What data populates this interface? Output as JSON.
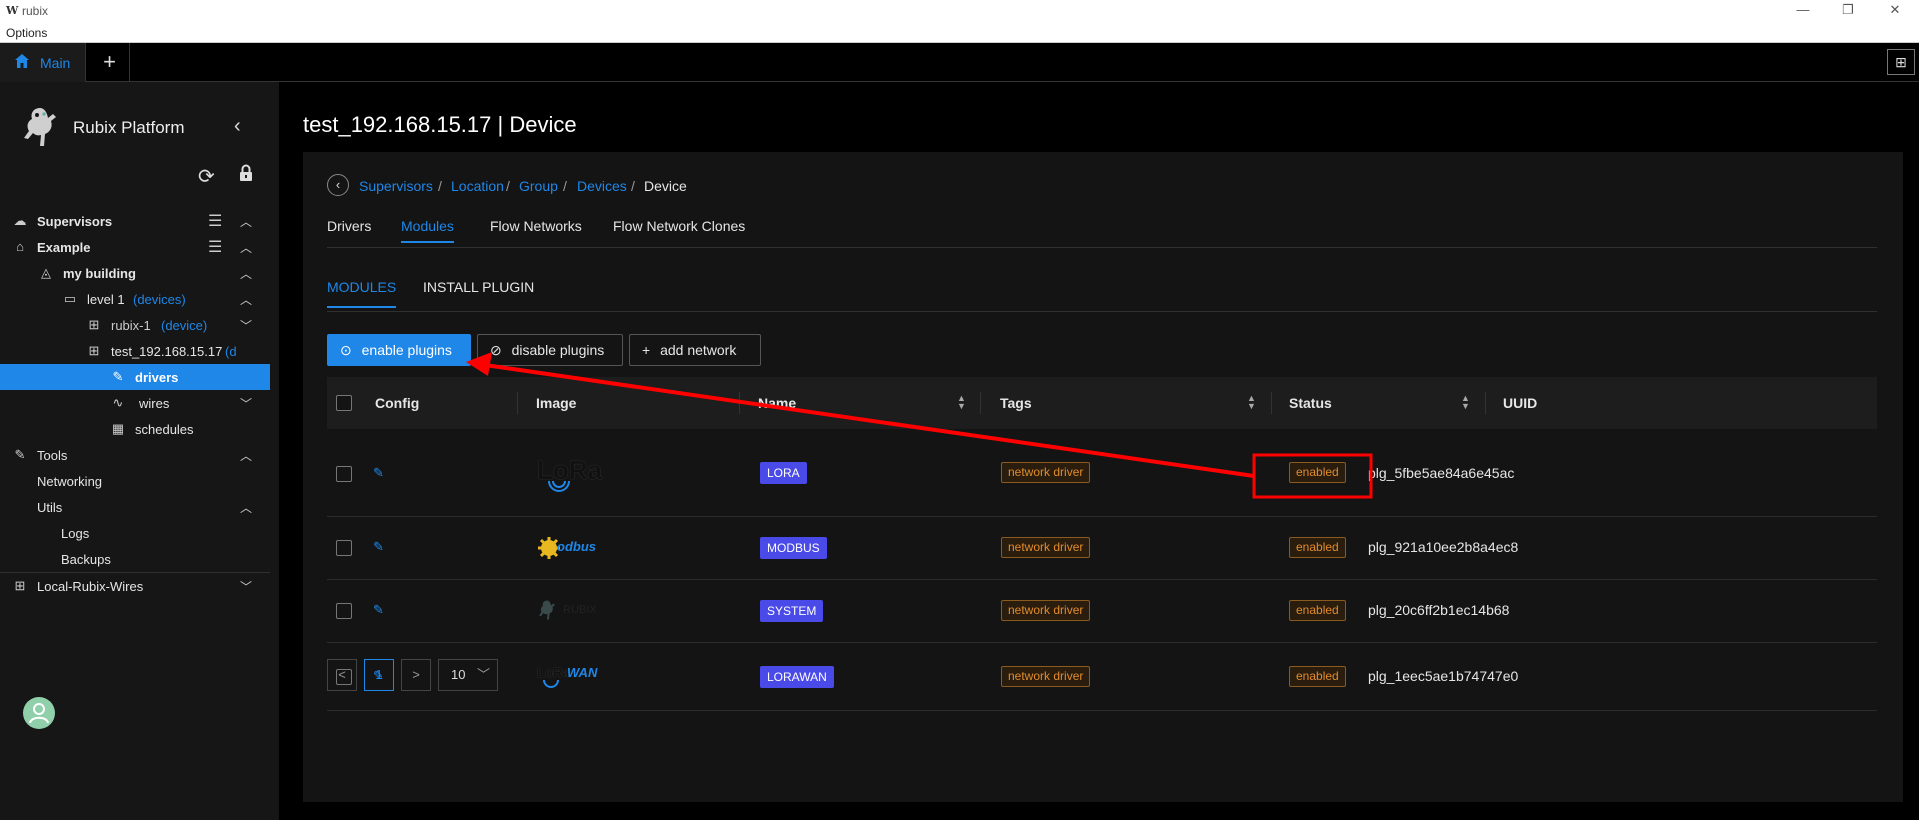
{
  "window": {
    "logo": "W",
    "title": "rubix",
    "menu": "Options"
  },
  "tabs": {
    "main_label": "Main",
    "add_label": "+",
    "layout_label": "⊞"
  },
  "sidebar": {
    "brand": "Rubix Platform",
    "items": [
      {
        "label": "Supervisors"
      },
      {
        "label": "Example"
      },
      {
        "label": "my building"
      },
      {
        "label": "level 1",
        "suffix": "(devices)"
      },
      {
        "label": "rubix-1",
        "suffix": "(device)"
      },
      {
        "label": "test_192.168.15.17",
        "suffix": "(d"
      },
      {
        "label": "drivers"
      },
      {
        "label": "wires"
      },
      {
        "label": "schedules"
      },
      {
        "label": "Tools"
      },
      {
        "label": "Networking"
      },
      {
        "label": "Utils"
      },
      {
        "label": "Logs"
      },
      {
        "label": "Backups"
      },
      {
        "label": "Local-Rubix-Wires"
      }
    ]
  },
  "page": {
    "title": "test_192.168.15.17 | Device",
    "breadcrumb": [
      "Supervisors",
      "/",
      "Location",
      "/",
      "Group",
      "/",
      "Devices",
      "/",
      "Device"
    ],
    "tabs": [
      "Drivers",
      "Modules",
      "Flow Networks",
      "Flow Network Clones"
    ],
    "subtabs": [
      "MODULES",
      "INSTALL PLUGIN"
    ],
    "buttons": {
      "enable": "enable plugins",
      "disable": "disable plugins",
      "add": "add network"
    },
    "columns": [
      "Config",
      "Image",
      "Name",
      "Tags",
      "Status",
      "UUID"
    ],
    "rows": [
      {
        "image": "LoRa",
        "name": "LORA",
        "tag": "network driver",
        "status": "enabled",
        "uuid": "plg_5fbe5ae84a6e45ac"
      },
      {
        "image": "Modbus",
        "name": "MODBUS",
        "tag": "network driver",
        "status": "enabled",
        "uuid": "plg_921a10ee2b8a4ec8"
      },
      {
        "image": "Rubix",
        "name": "SYSTEM",
        "tag": "network driver",
        "status": "enabled",
        "uuid": "plg_20c6ff2b1ec14b68"
      },
      {
        "image": "LoRaWAN",
        "name": "LORAWAN",
        "tag": "network driver",
        "status": "enabled",
        "uuid": "plg_1eec5ae1b74747e0"
      }
    ],
    "pagination": {
      "prev": "<",
      "page": "1",
      "next": ">",
      "page_size": "10"
    }
  },
  "colors": {
    "accent": "#1f87e8",
    "annotation": "#ff0000",
    "name_tag": "#4a4ae8",
    "status_tag": "#e08b2c"
  }
}
